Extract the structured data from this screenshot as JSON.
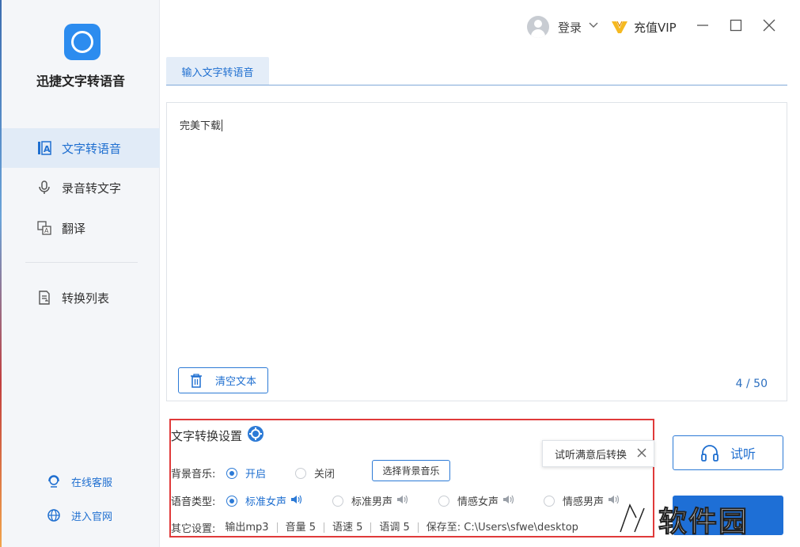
{
  "app": {
    "name": "迅捷文字转语音"
  },
  "sidebar": {
    "items": [
      {
        "label": "文字转语音",
        "icon": "text-to-speech-icon",
        "active": true
      },
      {
        "label": "录音转文字",
        "icon": "microphone-icon",
        "active": false
      },
      {
        "label": "翻译",
        "icon": "translate-icon",
        "active": false
      },
      {
        "label": "转换列表",
        "icon": "conversion-list-icon",
        "active": false
      }
    ],
    "bottom_links": [
      {
        "label": "在线客服",
        "icon": "customer-service-icon"
      },
      {
        "label": "进入官网",
        "icon": "globe-icon"
      }
    ]
  },
  "titlebar": {
    "login_label": "登录",
    "vip_label": "充值VIP"
  },
  "tab": {
    "label": "输入文字转语音"
  },
  "editor": {
    "text": "完美下载",
    "clear_label": "清空文本",
    "char_count": "4 / 50"
  },
  "settings": {
    "title": "文字转换设置",
    "bg_music_label": "背景音乐:",
    "bg_music_options": [
      {
        "label": "开启",
        "checked": true
      },
      {
        "label": "关闭",
        "checked": false
      }
    ],
    "choose_music_label": "选择背景音乐",
    "voice_type_label": "语音类型:",
    "voice_options": [
      {
        "label": "标准女声",
        "checked": true
      },
      {
        "label": "标准男声",
        "checked": false
      },
      {
        "label": "情感女声",
        "checked": false
      },
      {
        "label": "情感男声",
        "checked": false
      }
    ],
    "other_label": "其它设置:",
    "other_items": [
      "输出mp3",
      "音量 5",
      "语速 5",
      "语调 5",
      "保存至: C:\\Users\\sfwe\\desktop"
    ]
  },
  "tooltip": {
    "text": "试听满意后转换"
  },
  "actions": {
    "listen_label": "试听"
  },
  "watermark": {
    "text": "软件园"
  },
  "colors": {
    "accent": "#1f6fd0",
    "highlight_box": "#e03a3a",
    "sidebar_bg": "#f4f6f9"
  }
}
